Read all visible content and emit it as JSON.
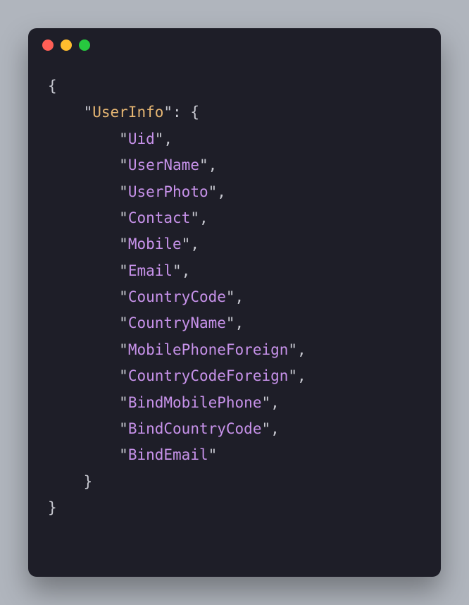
{
  "code": {
    "rootKey": "UserInfo",
    "fields": [
      "Uid",
      "UserName",
      "UserPhoto",
      "Contact",
      "Mobile",
      "Email",
      "CountryCode",
      "CountryName",
      "MobilePhoneForeign",
      "CountryCodeForeign",
      "BindMobilePhone",
      "BindCountryCode",
      "BindEmail"
    ]
  },
  "colors": {
    "bg": "#1e1e28",
    "key_top": "#e6b673",
    "key": "#c792ea",
    "punct": "#c8c9d1"
  }
}
